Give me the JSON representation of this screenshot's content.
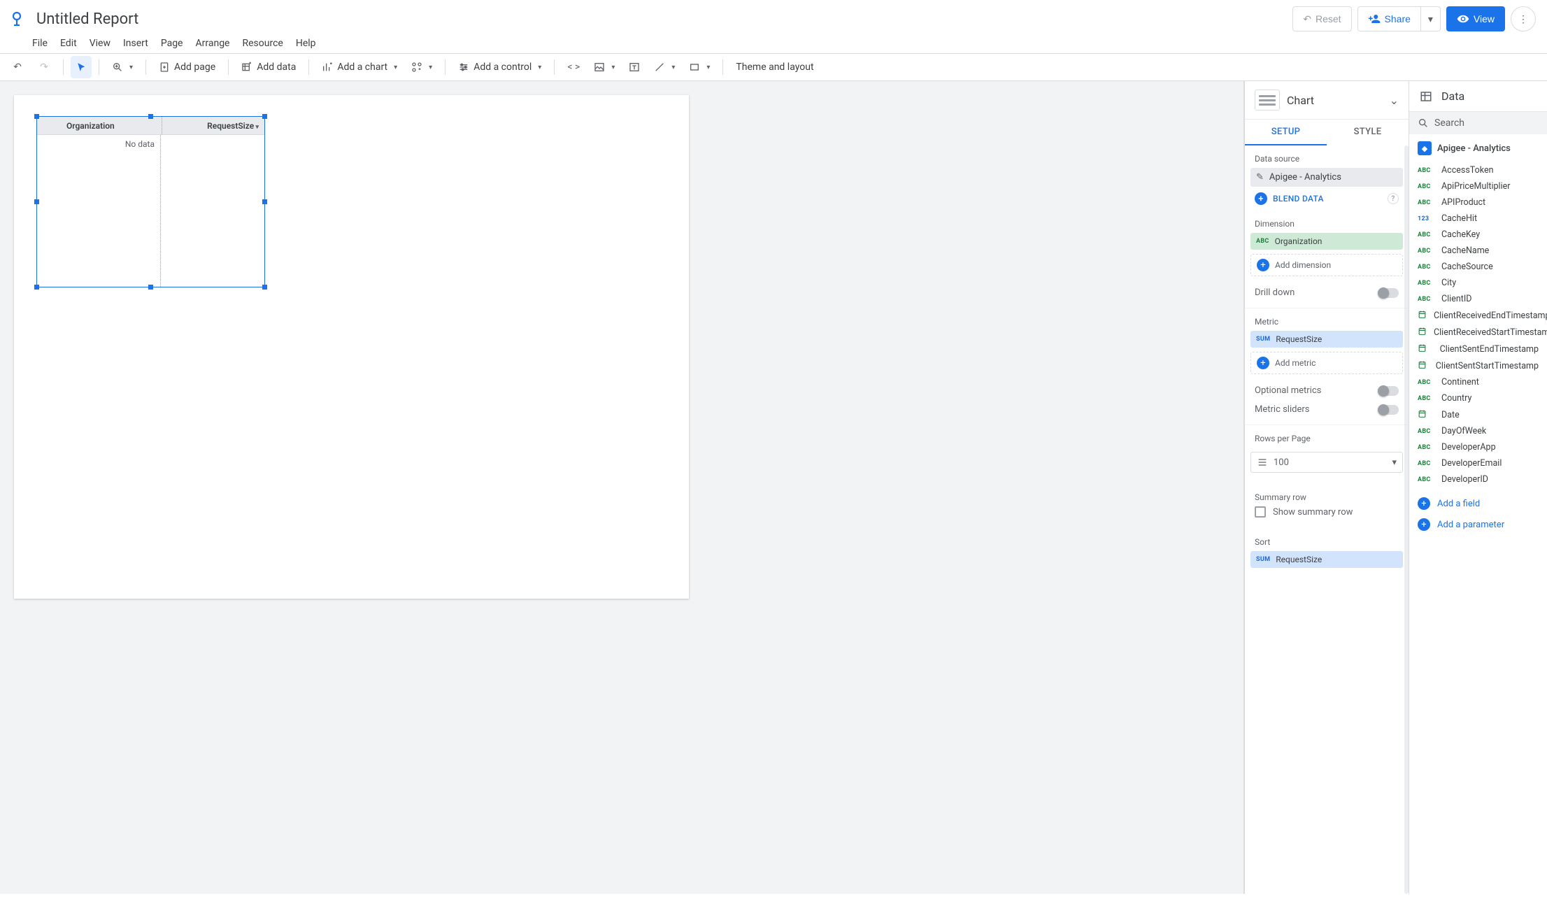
{
  "header": {
    "title": "Untitled Report",
    "reset": "Reset",
    "share": "Share",
    "view": "View"
  },
  "menubar": [
    "File",
    "Edit",
    "View",
    "Insert",
    "Page",
    "Arrange",
    "Resource",
    "Help"
  ],
  "toolbar": {
    "add_page": "Add page",
    "add_data": "Add data",
    "add_chart": "Add a chart",
    "add_control": "Add a control",
    "theme": "Theme and layout"
  },
  "canvas": {
    "table": {
      "col1": "Organization",
      "col2": "RequestSize",
      "nodata": "No data"
    }
  },
  "chart_panel": {
    "title": "Chart",
    "tab_setup": "SETUP",
    "tab_style": "STYLE",
    "data_source_lbl": "Data source",
    "data_source": "Apigee - Analytics",
    "blend": "BLEND DATA",
    "dimension_lbl": "Dimension",
    "dimension_type": "ABC",
    "dimension_val": "Organization",
    "add_dimension": "Add dimension",
    "drill_down": "Drill down",
    "metric_lbl": "Metric",
    "metric_type": "SUM",
    "metric_val": "RequestSize",
    "add_metric": "Add metric",
    "optional_metrics": "Optional metrics",
    "metric_sliders": "Metric sliders",
    "rows_lbl": "Rows per Page",
    "rows_val": "100",
    "summary_lbl": "Summary row",
    "show_summary": "Show summary row",
    "sort_lbl": "Sort",
    "sort_type": "SUM",
    "sort_val": "RequestSize"
  },
  "data_panel": {
    "title": "Data",
    "search_ph": "Search",
    "source": "Apigee - Analytics",
    "fields": [
      {
        "t": "ABC",
        "n": "AccessToken"
      },
      {
        "t": "ABC",
        "n": "ApiPriceMultiplier"
      },
      {
        "t": "ABC",
        "n": "APIProduct"
      },
      {
        "t": "123",
        "n": "CacheHit"
      },
      {
        "t": "ABC",
        "n": "CacheKey"
      },
      {
        "t": "ABC",
        "n": "CacheName"
      },
      {
        "t": "ABC",
        "n": "CacheSource"
      },
      {
        "t": "ABC",
        "n": "City"
      },
      {
        "t": "ABC",
        "n": "ClientID"
      },
      {
        "t": "DATE",
        "n": "ClientReceivedEndTimestamp"
      },
      {
        "t": "DATE",
        "n": "ClientReceivedStartTimestamp"
      },
      {
        "t": "DATE",
        "n": "ClientSentEndTimestamp"
      },
      {
        "t": "DATE",
        "n": "ClientSentStartTimestamp"
      },
      {
        "t": "ABC",
        "n": "Continent"
      },
      {
        "t": "ABC",
        "n": "Country"
      },
      {
        "t": "DATE",
        "n": "Date"
      },
      {
        "t": "ABC",
        "n": "DayOfWeek"
      },
      {
        "t": "ABC",
        "n": "DeveloperApp"
      },
      {
        "t": "ABC",
        "n": "DeveloperEmail"
      },
      {
        "t": "ABC",
        "n": "DeveloperID"
      }
    ],
    "add_field": "Add a field",
    "add_param": "Add a parameter"
  }
}
